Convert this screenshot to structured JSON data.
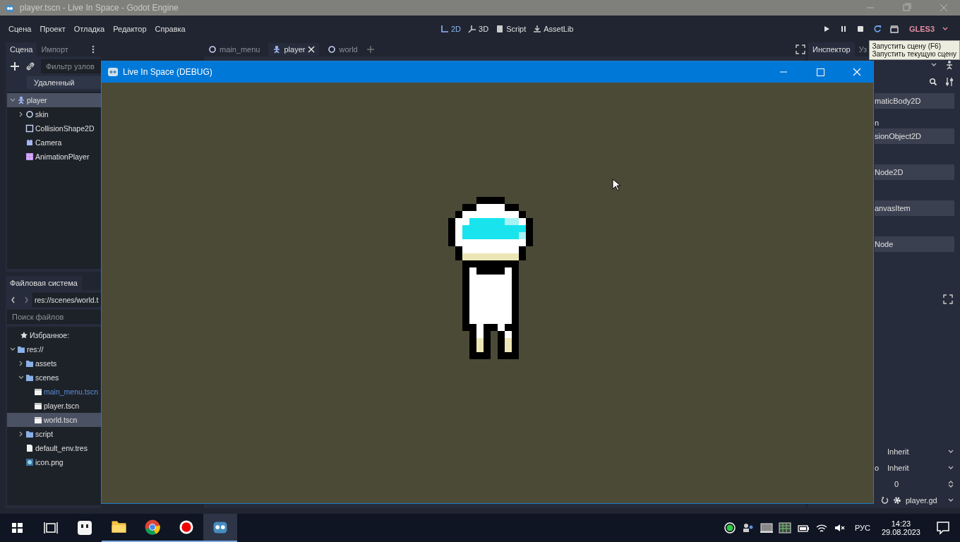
{
  "editor_window": {
    "title": "player.tscn - Live In Space - Godot Engine"
  },
  "menu": [
    "Сцена",
    "Проект",
    "Отладка",
    "Редактор",
    "Справка"
  ],
  "workspaces": [
    {
      "label": "2D",
      "kind": "plane",
      "selected": true
    },
    {
      "label": "3D",
      "kind": "space",
      "selected": false
    },
    {
      "label": "Script",
      "kind": "script",
      "selected": false
    },
    {
      "label": "AssetLib",
      "kind": "assetlib",
      "selected": false
    }
  ],
  "renderer": "GLES3",
  "tooltip": [
    "Запустить сцену (F6)",
    "Запустить текущую сцену"
  ],
  "scene_dock": {
    "tabs": [
      {
        "label": "Сцена",
        "selected": true
      },
      {
        "label": "Импорт",
        "selected": false
      }
    ],
    "filter": {
      "placeholder": "Фильтр узлов"
    },
    "remote_button": "Удаленный",
    "tree": [
      {
        "label": "player",
        "kind": "character",
        "selected": true,
        "expanded": true,
        "children": [
          {
            "label": "skin",
            "kind": "node2d",
            "selected": false,
            "expanded": false
          },
          {
            "label": "CollisionShape2D",
            "kind": "shape",
            "selected": false
          },
          {
            "label": "Camera",
            "kind": "camera",
            "selected": false
          },
          {
            "label": "AnimationPlayer",
            "kind": "animation",
            "selected": false
          }
        ]
      }
    ]
  },
  "filesystem": {
    "tab": "Файловая система",
    "path": "res://scenes/world.t",
    "search": {
      "placeholder": "Поиск файлов"
    },
    "favorites": "Избранное:",
    "tree": [
      {
        "label": "res://",
        "kind": "folder",
        "selected": false,
        "expanded": true,
        "children": [
          {
            "label": "assets",
            "kind": "folder",
            "selected": false,
            "expanded": false
          },
          {
            "label": "scenes",
            "kind": "folder",
            "selected": false,
            "expanded": true,
            "children": [
              {
                "label": "main_menu.tscn",
                "kind": "scene",
                "selected": false,
                "main_scene": true
              },
              {
                "label": "player.tscn",
                "kind": "scene",
                "selected": false,
                "main_scene": false
              },
              {
                "label": "world.tscn",
                "kind": "scene",
                "selected": true,
                "main_scene": false
              }
            ]
          },
          {
            "label": "script",
            "kind": "folder",
            "selected": false,
            "expanded": false
          },
          {
            "label": "default_env.tres",
            "kind": "file",
            "selected": false
          },
          {
            "label": "icon.png",
            "kind": "image",
            "selected": false
          }
        ]
      }
    ]
  },
  "scene_tabs": [
    {
      "label": "main_menu",
      "kind": "node2d",
      "selected": false
    },
    {
      "label": "player",
      "kind": "character",
      "selected": true
    },
    {
      "label": "world",
      "kind": "node2d",
      "selected": false
    }
  ],
  "inspector": {
    "tabs": [
      {
        "label": "Инспектор",
        "selected": true
      },
      {
        "label": "Уз",
        "selected": false
      }
    ],
    "items": [
      {
        "kind": "section",
        "label": "maticBody2D"
      },
      {
        "kind": "label",
        "label": "n"
      },
      {
        "kind": "section",
        "label": "sionObject2D"
      },
      {
        "kind": "section",
        "label": "Node2D"
      },
      {
        "kind": "section",
        "label": "anvasItem"
      },
      {
        "kind": "section",
        "label": "Node"
      }
    ],
    "properties": [
      {
        "kind": "select",
        "value": "Inherit"
      },
      {
        "kind": "select",
        "label": "o",
        "value": "Inherit"
      },
      {
        "kind": "spin",
        "value": "0"
      },
      {
        "kind": "script",
        "value": "player.gd"
      }
    ]
  },
  "game_window": {
    "title": "Live In Space (DEBUG)"
  },
  "taskbar": {
    "language": "РУС",
    "time": "14:23",
    "date": "29.08.2023"
  }
}
